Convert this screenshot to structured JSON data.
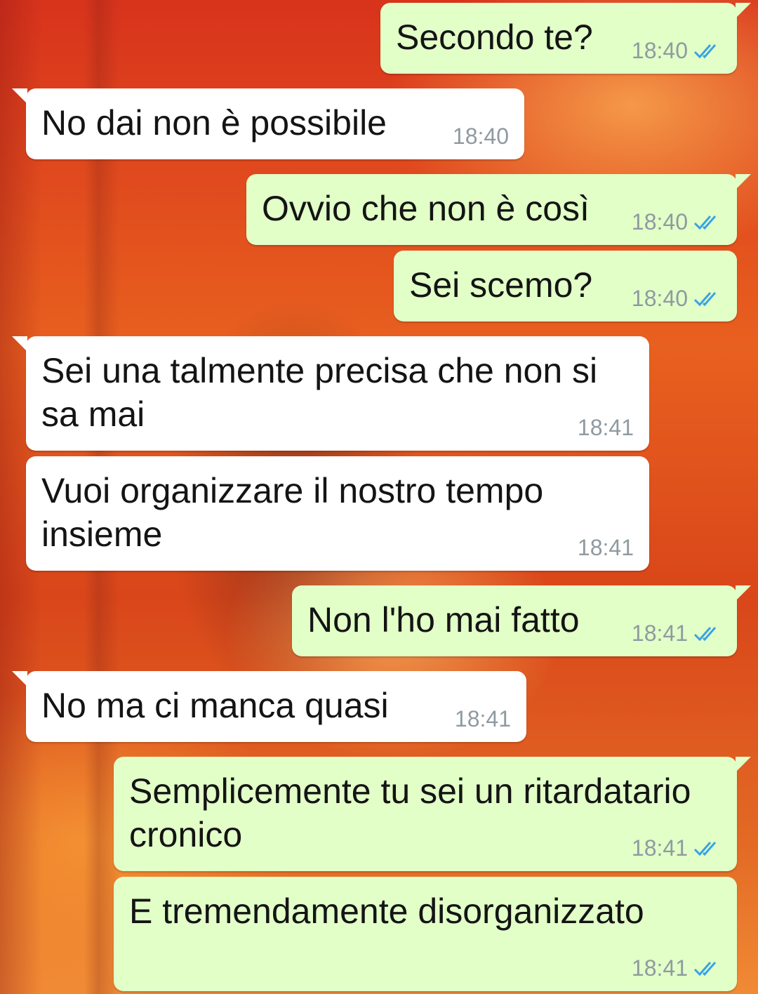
{
  "messages": [
    {
      "direction": "outgoing",
      "text": "Secondo te?",
      "time": "18:40",
      "status_icon": "double-check-read-icon"
    },
    {
      "direction": "incoming",
      "text": "No dai non è possibile",
      "time": "18:40"
    },
    {
      "direction": "outgoing",
      "text": "Ovvio che non è così",
      "time": "18:40",
      "status_icon": "double-check-read-icon"
    },
    {
      "direction": "outgoing",
      "text": "Sei scemo?",
      "time": "18:40",
      "status_icon": "double-check-read-icon"
    },
    {
      "direction": "incoming",
      "text": "Sei una talmente precisa che non si\nsa mai",
      "time": "18:41"
    },
    {
      "direction": "incoming",
      "text": "Vuoi organizzare il nostro tempo\ninsieme",
      "time": "18:41"
    },
    {
      "direction": "outgoing",
      "text": "Non l'ho mai fatto",
      "time": "18:41",
      "status_icon": "double-check-read-icon"
    },
    {
      "direction": "incoming",
      "text": "No ma ci manca quasi",
      "time": "18:41"
    },
    {
      "direction": "outgoing",
      "text": "Semplicemente tu sei un ritardatario\ncronico",
      "time": "18:41",
      "status_icon": "double-check-read-icon"
    },
    {
      "direction": "outgoing",
      "text": "E tremendamente disorganizzato",
      "time": "18:41",
      "status_icon": "double-check-read-icon"
    }
  ],
  "colors": {
    "outgoing_bubble": "#e2ffc8",
    "incoming_bubble": "#ffffff",
    "timestamp": "#8f9aa0",
    "read_ticks": "#3aa3e3"
  }
}
